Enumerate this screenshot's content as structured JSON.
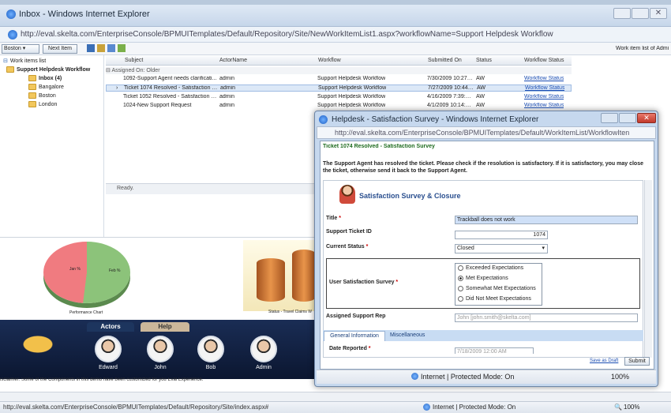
{
  "window": {
    "title": "Inbox - Windows Internet Explorer",
    "url": "http://eval.skelta.com/EnterpriseConsole/BPMUITemplates/Default/Repository/Site/NewWorkItemList1.aspx?workflowName=Support Helpdesk Workflow"
  },
  "toolbar": {
    "location": "Boston",
    "next_item": "Next Item",
    "right_text": "Work item list of Admi"
  },
  "tree": {
    "root": "Work items list",
    "workflow": "Support Helpdesk Workflow",
    "items": [
      "Inbox (4)",
      "Bangalore",
      "Boston",
      "London"
    ]
  },
  "grid": {
    "columns": [
      "Subject",
      "ActorName",
      "Workflow",
      "Submitted On",
      "Status",
      "Workflow Status"
    ],
    "group": "Assigned On: Older",
    "rows": [
      {
        "subject": "1092-Support Agent needs clarificati...",
        "actor": "admin",
        "workflow": "Support Helpdesk Workflow",
        "submitted": "7/30/2009 10:27:...",
        "status": "AW",
        "wstatus": "Workflow Status"
      },
      {
        "subject": "Ticket 1074 Resolved - Satisfaction S...",
        "actor": "admin",
        "workflow": "Support Helpdesk Workflow",
        "submitted": "7/27/2009 10:44:5...",
        "status": "AW",
        "wstatus": "Workflow Status"
      },
      {
        "subject": "Ticket 1052 Resolved - Satisfaction S...",
        "actor": "admin",
        "workflow": "Support Helpdesk Workflow",
        "submitted": "4/16/2009 7:39:2...",
        "status": "AW",
        "wstatus": "Workflow Status"
      },
      {
        "subject": "1024-New Support Request",
        "actor": "admin",
        "workflow": "Support Helpdesk Workflow",
        "submitted": "4/1/2009 10:14:1...",
        "status": "AW",
        "wstatus": "Workflow Status"
      }
    ],
    "ready": "Ready."
  },
  "dashboard": {
    "pie_caption": "Performance Chart",
    "bar_caption": "Status - Travel Claims W",
    "pie_label_left": "Jan %",
    "pie_label_right": "Feb %"
  },
  "actors": {
    "tabs": [
      "Actors",
      "Help"
    ],
    "people": [
      "Edward",
      "John",
      "Bob",
      "Admin"
    ]
  },
  "disclaimer": "isclaimer: Some of the Components in this demo have been customized for you Eval Experience.",
  "statusbar": {
    "url": "http://eval.skelta.com/EnterpriseConsole/BPMUITemplates/Default/Repository/Site/index.aspx#",
    "zone": "Internet | Protected Mode: On",
    "zoom": "100%"
  },
  "popup": {
    "title": "Helpdesk - Satisfaction Survey - Windows Internet Explorer",
    "url": "http://eval.skelta.com/EnterpriseConsole/BPMUITemplates/Default/WorkItemList/WorkflowIten",
    "heading": "Ticket 1074 Resolved - Satisfaction Survey",
    "instructions": "The Support Agent has resolved the ticket. Please check if the resolution is satisfactory. If it is satisfactory, you may close the ticket, otherwise send it back to the Support Agent.",
    "banner": "Satisfaction Survey & Closure",
    "fields": {
      "title_label": "Title",
      "title_value": "Trackball does not work",
      "ticket_label": "Support Ticket ID",
      "ticket_value": "1074",
      "status_label": "Current Status",
      "status_value": "Closed",
      "survey_label": "User Satisfaction Survey",
      "survey_options": [
        "Exceeded Expectations",
        "Met Expectations",
        "Somewhat Met Expectations",
        "Did Not Meet Expectations"
      ],
      "survey_selected": "Met Expectations",
      "rep_label": "Assigned Support Rep",
      "rep_value": "John [john.smith@skelta.com]",
      "date_label": "Date Reported",
      "date_value": "7/18/2009 12:00 AM"
    },
    "tabs": [
      "General Information",
      "Miscellaneous"
    ],
    "save_draft": "Save as Draft",
    "submit": "Submit",
    "zone": "Internet | Protected Mode: On",
    "zoom": "100%"
  }
}
